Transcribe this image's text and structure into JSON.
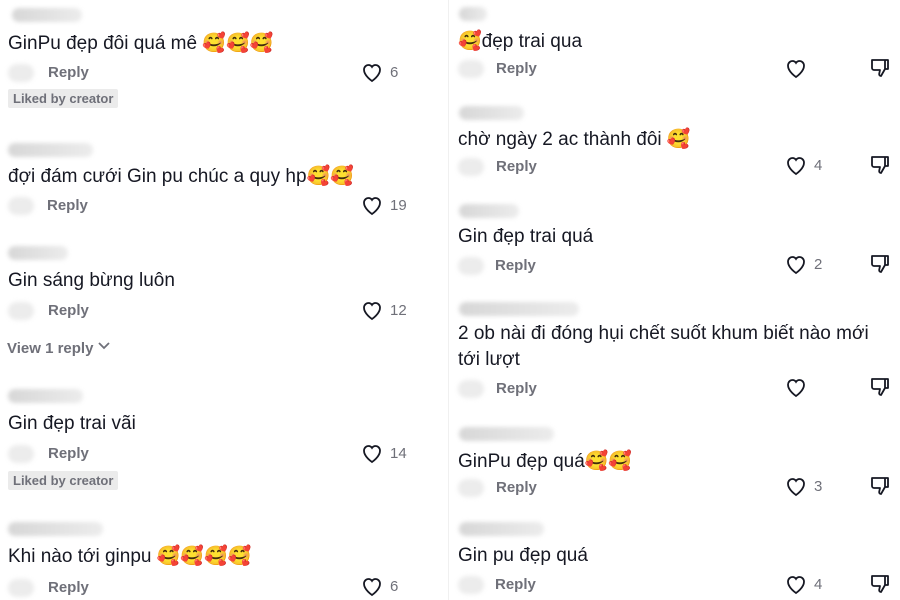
{
  "left": [
    {
      "text": "GinPu đẹp đôi quá mê 🥰🥰🥰",
      "reply": "Reply",
      "likes": "6",
      "badge": "Liked by creator"
    },
    {
      "text": "đợi đám cưới Gin pu chúc a quy hp🥰🥰",
      "reply": "Reply",
      "likes": "19"
    },
    {
      "text": "Gin sáng bừng luôn",
      "reply": "Reply",
      "likes": "12",
      "view_replies": "View 1 reply"
    },
    {
      "text": "Gin đẹp trai vãi",
      "reply": "Reply",
      "likes": "14",
      "badge": "Liked by creator"
    },
    {
      "text": "Khi nào tới ginpu 🥰🥰🥰🥰",
      "reply": "Reply",
      "likes": "6"
    }
  ],
  "right": [
    {
      "text": "🥰đẹp trai qua",
      "reply": "Reply",
      "likes": ""
    },
    {
      "text": "chờ ngày 2 ac thành đôi 🥰",
      "reply": "Reply",
      "likes": "4"
    },
    {
      "text": "Gin đẹp trai quá",
      "reply": "Reply",
      "likes": "2"
    },
    {
      "text": "2 ob nài đi đóng hụi chết suốt khum biết nào mới tới lượt",
      "reply": "Reply",
      "likes": ""
    },
    {
      "text": "GinPu đẹp quá🥰🥰",
      "reply": "Reply",
      "likes": "3"
    },
    {
      "text": "Gin pu đẹp quá",
      "reply": "Reply",
      "likes": "4"
    }
  ],
  "icons": {
    "like": "heart-outline-icon",
    "dislike": "thumbs-down-icon",
    "chevron": "chevron-down-icon"
  }
}
